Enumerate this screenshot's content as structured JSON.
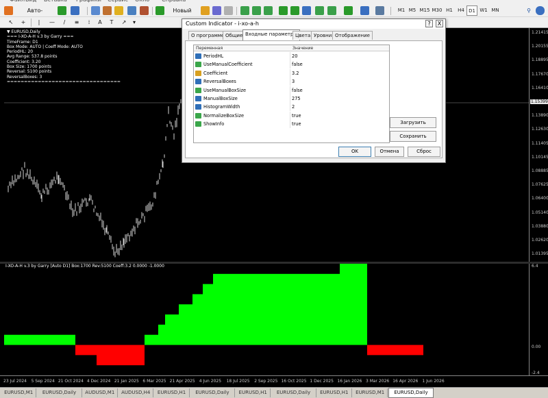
{
  "menu": [
    "Файл",
    "Вид",
    "Вставка",
    "Графики",
    "Сервис",
    "Окно",
    "Справка"
  ],
  "toolbar": {
    "auto_trading": "Авто-торговля",
    "new_order": "Новый ордер"
  },
  "timeframes": [
    "M1",
    "M5",
    "M15",
    "M30",
    "H1",
    "H4",
    "D1",
    "W1",
    "MN"
  ],
  "active_timeframe": "D1",
  "chart": {
    "symbol_line": "▼ EURUSD,Daily",
    "info_lines": [
      "=== I-XO-A-H v.3 by Garry ===",
      "TimeFrame: D1",
      "Box Mode: AUTO | Coeff Mode: AUTO",
      "PeriodHL: 20",
      "Avg Range: 537.8 points",
      "Coefficient: 3.20",
      "Box Size: 1700 points",
      "Reversal: 5100 points",
      "ReversalBoxes: 3",
      "================================="
    ],
    "price_labels": [
      "1.21415",
      "1.20155",
      "1.18895",
      "1.17670",
      "1.16410",
      "1.15399",
      "1.13890",
      "1.12630",
      "1.11405",
      "1.10145",
      "1.08885",
      "1.07625",
      "1.06400",
      "1.05140",
      "1.03880",
      "1.02620",
      "1.01395"
    ],
    "current_price": "1.15399",
    "price_ylim": [
      1.01,
      1.22
    ]
  },
  "indicator": {
    "title": "I-XO-A-H v.3 by Garry [Auto D1] Box:1700 Rev:5100 Coeff:3.2 0.0000 -1.0000",
    "axis_labels": [
      "6.4",
      "0.00",
      "-2.4"
    ],
    "ylim": [
      -2.4,
      6.4
    ],
    "positive_color": "#00ff00",
    "negative_color": "#ff0000"
  },
  "time_labels": [
    "23 Jul 2024",
    "5 Sep 2024",
    "21 Oct 2024",
    "4 Dec 2024",
    "21 Jan 2025",
    "6 Mar 2025",
    "21 Apr 2025",
    "4 Jun 2025",
    "18 Jul 2025",
    "2 Sep 2025",
    "16 Oct 2025",
    "1 Dec 2025",
    "16 Jan 2026",
    "3 Mar 2026",
    "16 Apr 2026",
    "1 Jun 2026"
  ],
  "bottom_tabs": [
    "EURUSD,M1",
    "EURUSD,Daily",
    "AUDUSD,M1",
    "AUDUSD,H4",
    "EURUSD,H1",
    "EURUSD,Daily",
    "EURUSD,H1",
    "EURUSD,Daily",
    "EURUSD,H1",
    "EURUSD,M1",
    "EURUSD,Daily"
  ],
  "active_tab_index": 10,
  "dialog": {
    "title": "Custom Indicator - i-xo-a-h",
    "help_button": "?",
    "close_button": "X",
    "tabs": [
      "О программе",
      "Общие",
      "Входные параметры",
      "Цвета",
      "Уровни",
      "Отображение"
    ],
    "active_tab": "Входные параметры",
    "columns": [
      "Переменная",
      "Значение"
    ],
    "params": [
      {
        "name": "PeriodHL",
        "value": "20",
        "icon": "int-icon"
      },
      {
        "name": "UseManualCoefficient",
        "value": "false",
        "icon": "bool-icon"
      },
      {
        "name": "Coefficient",
        "value": "3.2",
        "icon": "double-icon"
      },
      {
        "name": "ReversalBoxes",
        "value": "3",
        "icon": "int-icon"
      },
      {
        "name": "UseManualBoxSize",
        "value": "false",
        "icon": "bool-icon"
      },
      {
        "name": "ManualBoxSize",
        "value": "275",
        "icon": "int-icon"
      },
      {
        "name": "HistogramWidth",
        "value": "2",
        "icon": "int-icon"
      },
      {
        "name": "NormalizeBoxSize",
        "value": "true",
        "icon": "bool-icon"
      },
      {
        "name": "ShowInfo",
        "value": "true",
        "icon": "bool-icon"
      }
    ],
    "load_button": "Загрузить",
    "save_button": "Сохранить",
    "ok_button": "OK",
    "cancel_button": "Отмена",
    "reset_button": "Сброс"
  }
}
